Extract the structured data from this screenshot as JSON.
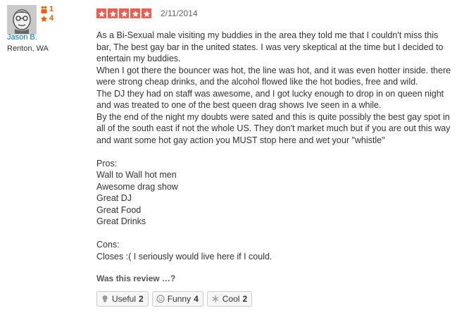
{
  "user": {
    "name": "Jason B.",
    "location": "Renton, WA",
    "friends_count": "1",
    "reviews_count": "4"
  },
  "review": {
    "rating": 5,
    "rating_max": 5,
    "date": "2/11/2014",
    "lines": [
      "As a Bi-Sexual male visiting my buddies in the area they told me that I couldn't miss this bar, The best gay bar in the united states. I was very skeptical at the time but I decided to entertain my buddies.",
      "When I got there the bouncer was hot, the line was hot, and it was even hotter inside. there were strong cheap drinks, and the alcohol flowed like the hot bodies, free and wild.",
      "The DJ they had on staff was awesome, and I got lucky enough to drop in on queen night and was treated to one of the best queen drag shows Ive seen in a while.",
      "By the end of the night my doubts were sated and this is quite possibly the best gay spot in all of the south east if not the whole US. They don't market much but if you are out this way and want some hot gay action you MUST stop here and wet your \"whistle\"",
      "",
      "Pros:",
      "Wall to Wall hot men",
      "Awesome drag show",
      "Great DJ",
      "Great Food",
      "Great Drinks",
      "",
      "Cons:",
      "Closes :( I seriously would live here if I could."
    ]
  },
  "feedback": {
    "prompt": "Was this review …?",
    "buttons": [
      {
        "label": "Useful",
        "count": "2",
        "icon": "lightbulb-icon"
      },
      {
        "label": "Funny",
        "count": "4",
        "icon": "smiley-icon"
      },
      {
        "label": "Cool",
        "count": "2",
        "icon": "snowflake-icon"
      }
    ]
  },
  "colors": {
    "star": "#f15c4f",
    "stat_orange": "#f15c00",
    "link_blue": "#0073bb"
  }
}
